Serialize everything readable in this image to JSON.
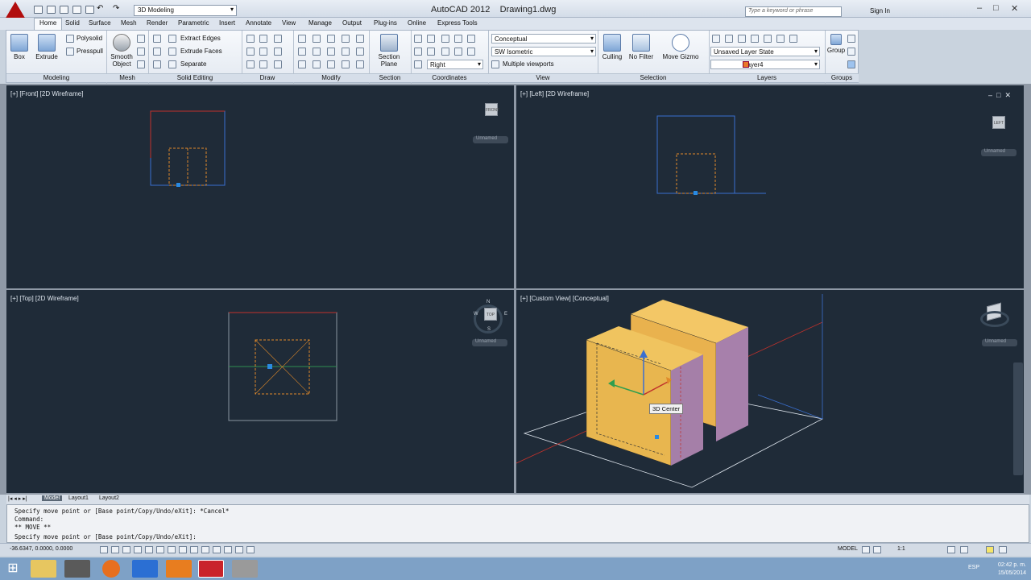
{
  "app": {
    "workspace": "3D Modeling",
    "title": "AutoCAD 2012",
    "document": "Drawing1.dwg",
    "search_placeholder": "Type a keyword or phrase",
    "signin": "Sign In"
  },
  "ribbon_tabs": [
    "Home",
    "Solid",
    "Surface",
    "Mesh",
    "Render",
    "Parametric",
    "Insert",
    "Annotate",
    "View",
    "Manage",
    "Output",
    "Plug-ins",
    "Online",
    "Express Tools"
  ],
  "ribbon": {
    "modeling": {
      "box": "Box",
      "extrude": "Extrude",
      "polysolid": "Polysolid",
      "presspull": "Presspull",
      "label": "Modeling"
    },
    "mesh": {
      "smooth_line1": "Smooth",
      "smooth_line2": "Object",
      "label": "Mesh"
    },
    "solid_editing": {
      "extract_edges": "Extract Edges",
      "extrude_faces": "Extrude Faces",
      "separate": "Separate",
      "label": "Solid Editing"
    },
    "draw": {
      "label": "Draw"
    },
    "modify": {
      "label": "Modify"
    },
    "section": {
      "plane_line1": "Section",
      "plane_line2": "Plane",
      "label": "Section"
    },
    "coordinates": {
      "label": "Coordinates",
      "view_combo": "Right"
    },
    "view": {
      "visual_style": "Conceptual",
      "view_preset": "SW Isometric",
      "viewports": "Multiple viewports",
      "label": "View"
    },
    "selection": {
      "culling": "Culling",
      "nofilter": "No Filter",
      "gizmo": "Move Gizmo",
      "label": "Selection"
    },
    "layers": {
      "state": "Unsaved Layer State",
      "layer": "Layer4",
      "label": "Layers"
    },
    "groups": {
      "group": "Group",
      "label": "Groups"
    }
  },
  "viewports": {
    "front": {
      "label": "[+] [Front] [2D Wireframe]",
      "ucs": "Unnamed",
      "cube": "FRONT"
    },
    "left": {
      "label": "[+] [Left] [2D Wireframe]",
      "ucs": "Unnamed",
      "cube": "LEFT"
    },
    "top": {
      "label": "[+] [Top] [2D Wireframe]",
      "ucs": "Unnamed",
      "cube": "TOP",
      "compass": [
        "N",
        "W",
        "E",
        "S"
      ]
    },
    "custom": {
      "label": "[+] [Custom View] [Conceptual]",
      "ucs": "Unnamed",
      "tooltip": "3D Center"
    }
  },
  "layout_tabs": [
    "Model",
    "Layout1",
    "Layout2"
  ],
  "command_lines": [
    "Specify move point or [Base point/Copy/Undo/eXit]: *Cancel*",
    "Command:",
    "** MOVE **",
    "Specify move point or [Base point/Copy/Undo/eXit]:"
  ],
  "status": {
    "coords": "-36.6347, 0.0000, 0.0000",
    "model": "MODEL",
    "scale": "1:1"
  },
  "taskbar": {
    "lang": "ESP",
    "time": "02:42 p. m.",
    "date": "15/05/2014"
  },
  "colors": {
    "viewport_bg": "#1f2b38",
    "solid_face": "#e8b64f",
    "purple_face": "#a57fa8",
    "accent": "#b10d0d"
  }
}
